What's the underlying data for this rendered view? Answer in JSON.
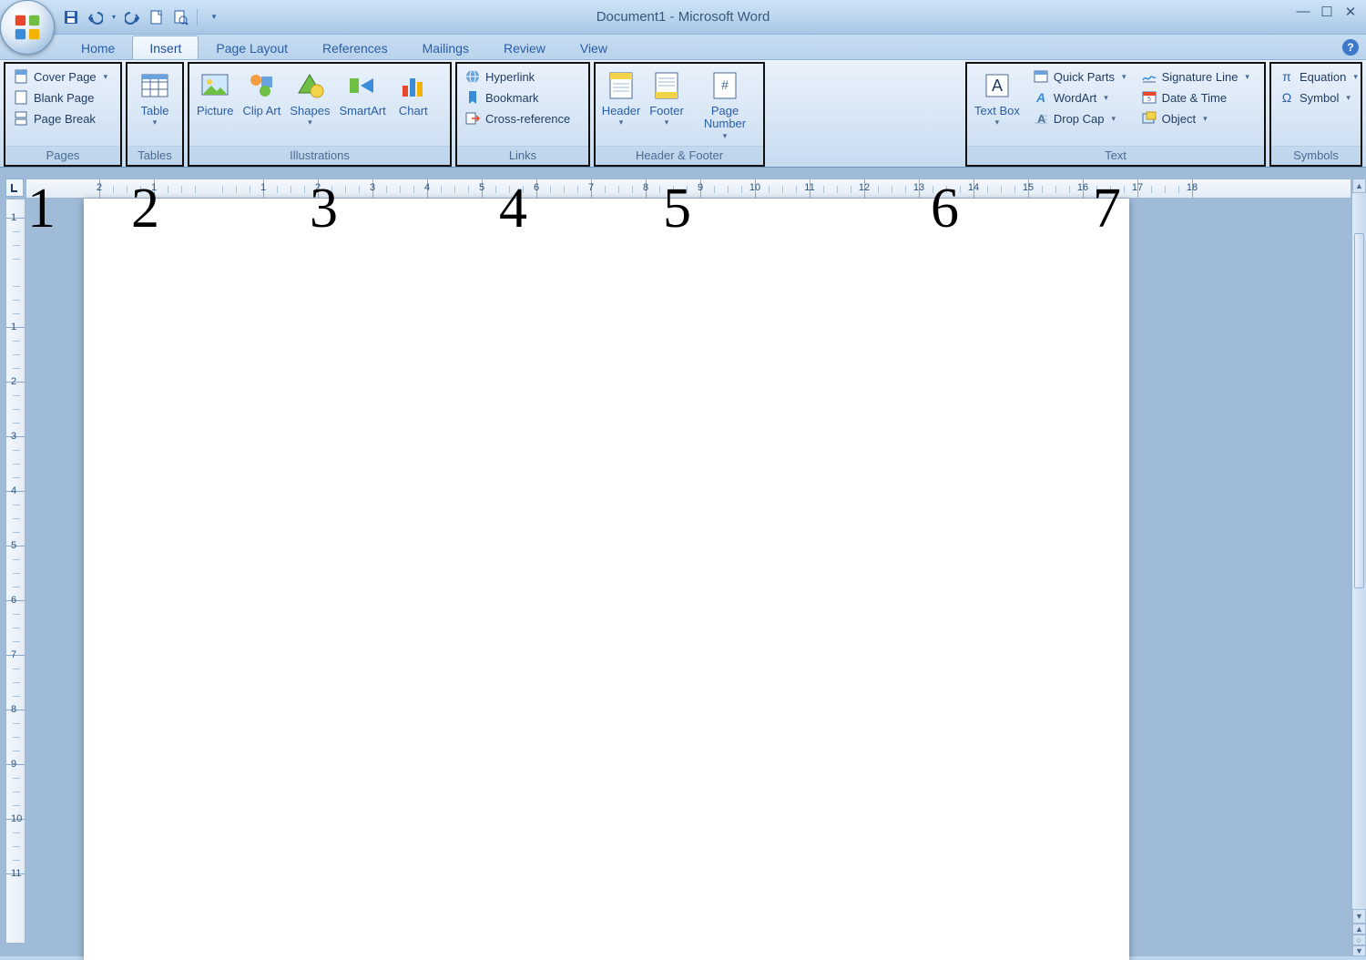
{
  "title": "Document1 - Microsoft Word",
  "qat": {
    "save": "save-icon",
    "undo": "undo-icon",
    "redo": "redo-icon",
    "new": "new-doc-icon",
    "print_preview": "print-preview-icon"
  },
  "tabs": [
    "Home",
    "Insert",
    "Page Layout",
    "References",
    "Mailings",
    "Review",
    "View"
  ],
  "active_tab": "Insert",
  "ribbon": {
    "pages": {
      "label": "Pages",
      "cover": "Cover Page",
      "blank": "Blank Page",
      "break": "Page Break"
    },
    "tables": {
      "label": "Tables",
      "table": "Table"
    },
    "illustrations": {
      "label": "Illustrations",
      "picture": "Picture",
      "clip": "Clip Art",
      "shapes": "Shapes",
      "smartart": "SmartArt",
      "chart": "Chart"
    },
    "links": {
      "label": "Links",
      "hyperlink": "Hyperlink",
      "bookmark": "Bookmark",
      "cross": "Cross-reference"
    },
    "headerfooter": {
      "label": "Header & Footer",
      "header": "Header",
      "footer": "Footer",
      "pagenum": "Page Number"
    },
    "text": {
      "label": "Text",
      "textbox": "Text Box",
      "quickparts": "Quick Parts",
      "wordart": "WordArt",
      "dropcap": "Drop Cap",
      "sigline": "Signature Line",
      "datetime": "Date & Time",
      "object": "Object"
    },
    "symbols": {
      "label": "Symbols",
      "equation": "Equation",
      "symbol": "Symbol"
    }
  },
  "ruler": {
    "h_labels": [
      2,
      1,
      1,
      2,
      3,
      4,
      5,
      6,
      7,
      8,
      9,
      10,
      11,
      12,
      13,
      14,
      15,
      16,
      17,
      18
    ],
    "v_labels": [
      1,
      1,
      2,
      3,
      4,
      5,
      6,
      7,
      8,
      9,
      10,
      11
    ]
  },
  "overlays": [
    "1",
    "2",
    "3",
    "4",
    "5",
    "6",
    "7"
  ],
  "colors": {
    "accent": "#2a5da5",
    "border": "#8fb3d9",
    "panel": "#d6e5f5"
  }
}
